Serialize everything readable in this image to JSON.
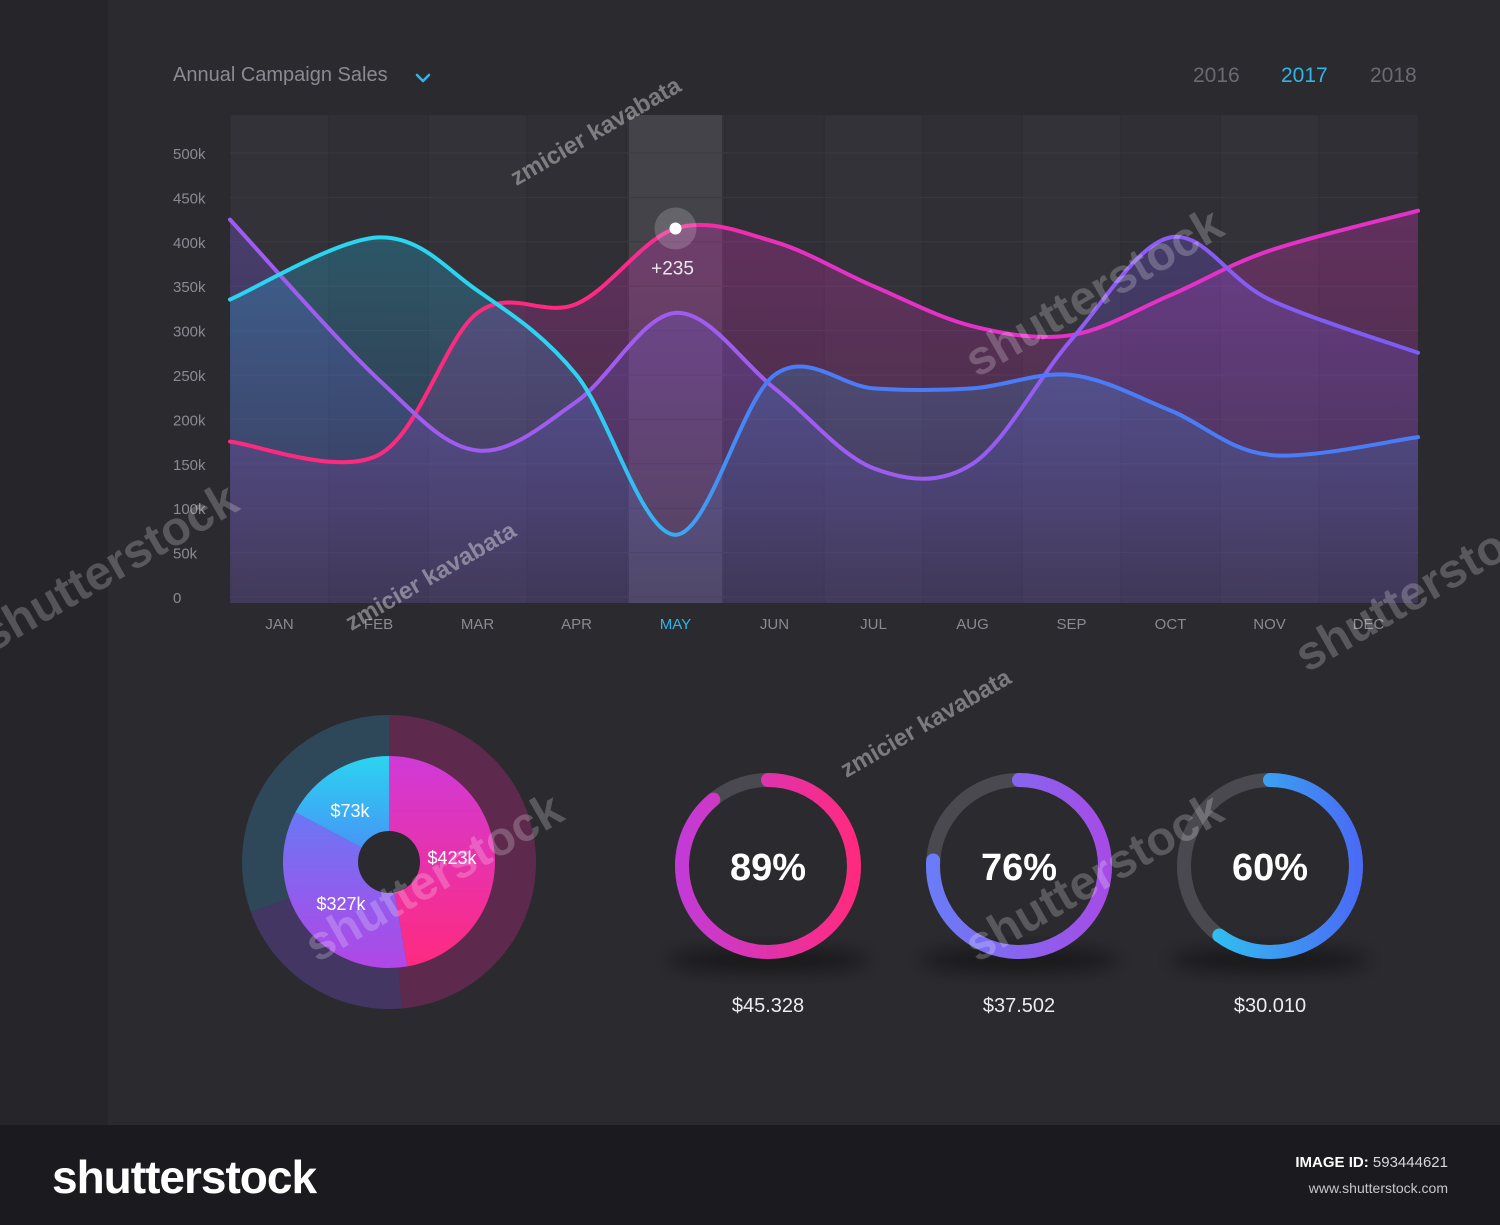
{
  "header": {
    "title": "Annual Campaign Sales",
    "years": [
      "2016",
      "2017",
      "2018"
    ],
    "active_year": "2017"
  },
  "colors": {
    "background": "#2b2a2f",
    "panel": "#313035",
    "active_month": "#2fb6e8",
    "magenta": "#e431c8",
    "pink": "#ff2a7f",
    "purple": "#a05cf0",
    "violet": "#7b5cf5",
    "cyan": "#2bd4f0",
    "blue": "#4a7cf7"
  },
  "chart_data": [
    {
      "type": "area",
      "title": "Annual Campaign Sales",
      "xlabel": "",
      "ylabel": "",
      "categories": [
        "JAN",
        "FEB",
        "MAR",
        "APR",
        "MAY",
        "JUN",
        "JUL",
        "AUG",
        "SEP",
        "OCT",
        "NOV",
        "DEC"
      ],
      "y_tick_labels": [
        "0",
        "50k",
        "100k",
        "150k",
        "200k",
        "250k",
        "300k",
        "350k",
        "400k",
        "450k",
        "500k"
      ],
      "ylim": [
        0,
        500
      ],
      "highlighted_category": "MAY",
      "annotation": {
        "category": "MAY",
        "value": 415,
        "text": "+235"
      },
      "grid": true,
      "legend": "none",
      "series": [
        {
          "color": "magenta-pink",
          "values": [
            175,
            160,
            320,
            330,
            415,
            400,
            350,
            305,
            295,
            340,
            390,
            435
          ]
        },
        {
          "color": "purple",
          "values": [
            425,
            245,
            165,
            220,
            320,
            235,
            145,
            150,
            290,
            405,
            335,
            275
          ]
        },
        {
          "color": "cyan-blue",
          "values": [
            335,
            405,
            345,
            250,
            70,
            250,
            235,
            235,
            250,
            210,
            160,
            180
          ]
        }
      ]
    },
    {
      "type": "pie",
      "labels": [
        "$73k",
        "$423k",
        "$327k"
      ],
      "values": [
        73,
        423,
        327
      ],
      "legend": "none"
    },
    {
      "type": "pie",
      "title": "",
      "legend": "none",
      "gauges": [
        {
          "percent": 89,
          "label": "89%",
          "amount": "$45.328",
          "color": "magenta-pink"
        },
        {
          "percent": 76,
          "label": "76%",
          "amount": "$37.502",
          "color": "blue-violet"
        },
        {
          "percent": 60,
          "label": "60%",
          "amount": "$30.010",
          "color": "cyan-blue"
        }
      ]
    }
  ],
  "watermarks": {
    "brand": "shutterstock",
    "author": "zmicier kavabata"
  },
  "footer": {
    "logo": "shutterstock",
    "image_id_label": "IMAGE ID:",
    "image_id": "593444621",
    "url": "www.shutterstock.com"
  }
}
